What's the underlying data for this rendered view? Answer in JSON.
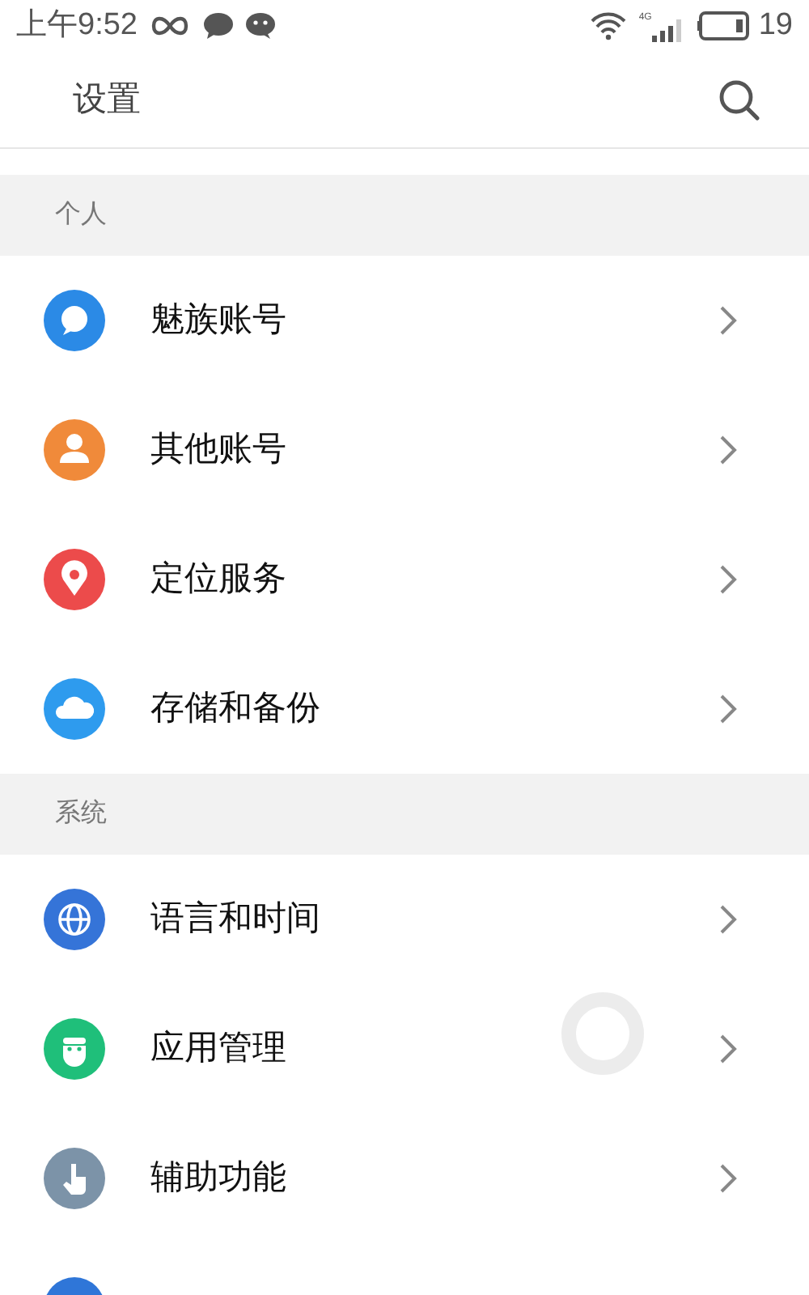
{
  "status_bar": {
    "time": "上午9:52",
    "network": "4G",
    "battery": "19"
  },
  "header": {
    "title": "设置"
  },
  "sections": [
    {
      "title": "个人",
      "items": [
        {
          "kind": "bubble",
          "label": "魅族账号"
        },
        {
          "kind": "person",
          "label": "其他账号"
        },
        {
          "kind": "pin",
          "label": "定位服务"
        },
        {
          "kind": "cloud",
          "label": "存储和备份"
        }
      ]
    },
    {
      "title": "系统",
      "items": [
        {
          "kind": "globe",
          "label": "语言和时间"
        },
        {
          "kind": "robot",
          "label": "应用管理"
        },
        {
          "kind": "hand",
          "label": "辅助功能"
        },
        {
          "kind": "partial"
        }
      ]
    }
  ]
}
